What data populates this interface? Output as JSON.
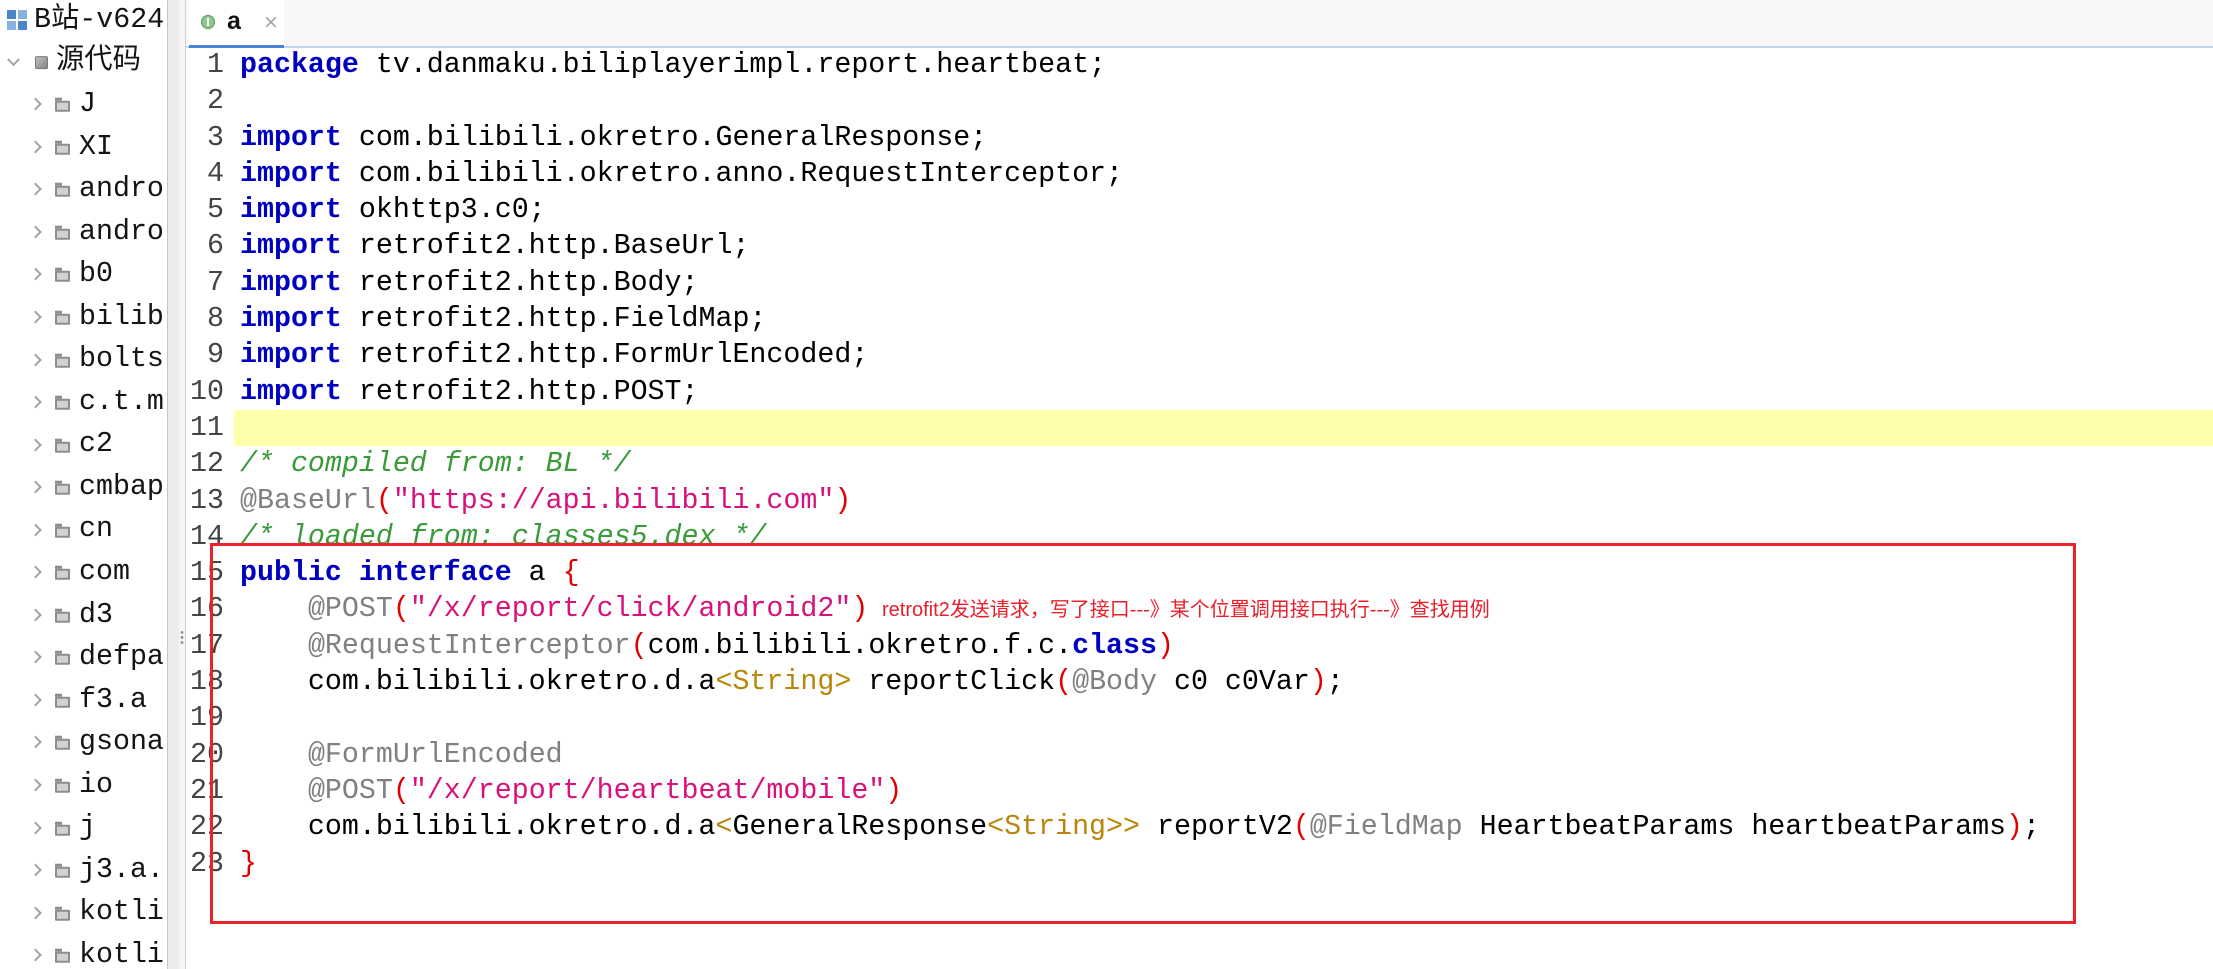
{
  "sidebar": {
    "project": {
      "label": "B站-v624",
      "icon": "project-icon"
    },
    "root": {
      "label": "源代码",
      "icon": "source-root-icon",
      "expanded": true
    },
    "item_icon": "package-icon",
    "items": [
      {
        "label": "J"
      },
      {
        "label": "XI"
      },
      {
        "label": "andro"
      },
      {
        "label": "andro"
      },
      {
        "label": "b0"
      },
      {
        "label": "bilib"
      },
      {
        "label": "bolts"
      },
      {
        "label": "c.t.m"
      },
      {
        "label": "c2"
      },
      {
        "label": "cmbap"
      },
      {
        "label": "cn"
      },
      {
        "label": "com"
      },
      {
        "label": "d3"
      },
      {
        "label": "defpa"
      },
      {
        "label": "f3.a"
      },
      {
        "label": "gsona"
      },
      {
        "label": "io"
      },
      {
        "label": "j"
      },
      {
        "label": "j3.a."
      },
      {
        "label": "kotli"
      },
      {
        "label": "kotli"
      }
    ]
  },
  "tabs": [
    {
      "label": "a",
      "close": "×",
      "icon": "interface-icon",
      "active": true
    }
  ],
  "editor": {
    "current_line": 11,
    "lines": [
      {
        "n": 1,
        "tokens": [
          {
            "keyword": "package"
          },
          {
            "plain": " tv.danmaku.biliplayerimpl.report.heartbeat;"
          }
        ]
      },
      {
        "n": 2,
        "tokens": []
      },
      {
        "n": 3,
        "tokens": [
          {
            "keyword": "import"
          },
          {
            "plain": " com.bilibili.okretro.GeneralResponse;"
          }
        ]
      },
      {
        "n": 4,
        "tokens": [
          {
            "keyword": "import"
          },
          {
            "plain": " com.bilibili.okretro.anno.RequestInterceptor;"
          }
        ]
      },
      {
        "n": 5,
        "tokens": [
          {
            "keyword": "import"
          },
          {
            "plain": " okhttp3.c0;"
          }
        ]
      },
      {
        "n": 6,
        "tokens": [
          {
            "keyword": "import"
          },
          {
            "plain": " retrofit2.http.BaseUrl;"
          }
        ]
      },
      {
        "n": 7,
        "tokens": [
          {
            "keyword": "import"
          },
          {
            "plain": " retrofit2.http.Body;"
          }
        ]
      },
      {
        "n": 8,
        "tokens": [
          {
            "keyword": "import"
          },
          {
            "plain": " retrofit2.http.FieldMap;"
          }
        ]
      },
      {
        "n": 9,
        "tokens": [
          {
            "keyword": "import"
          },
          {
            "plain": " retrofit2.http.FormUrlEncoded;"
          }
        ]
      },
      {
        "n": 10,
        "tokens": [
          {
            "keyword": "import"
          },
          {
            "plain": " retrofit2.http.POST;"
          }
        ]
      },
      {
        "n": 11,
        "tokens": []
      },
      {
        "n": 12,
        "tokens": [
          {
            "comment": "/* compiled from: BL */"
          }
        ]
      },
      {
        "n": 13,
        "tokens": [
          {
            "annotation": "@BaseUrl"
          },
          {
            "bracket": "("
          },
          {
            "string": "\"https://api.bilibili.com\""
          },
          {
            "bracket": ")"
          }
        ]
      },
      {
        "n": 14,
        "tokens": [
          {
            "comment": "/* loaded from: classes5.dex */"
          }
        ]
      },
      {
        "n": 15,
        "tokens": [
          {
            "keyword": "public"
          },
          {
            "plain": " "
          },
          {
            "keyword": "interface"
          },
          {
            "plain": " a "
          },
          {
            "bracket": "{"
          }
        ]
      },
      {
        "n": 16,
        "tokens": [
          {
            "plain": "    "
          },
          {
            "annotation": "@POST"
          },
          {
            "bracket": "("
          },
          {
            "string": "\"/x/report/click/android2\""
          },
          {
            "bracket": ")"
          }
        ]
      },
      {
        "n": 17,
        "tokens": [
          {
            "plain": "    "
          },
          {
            "annotation": "@RequestInterceptor"
          },
          {
            "bracket": "("
          },
          {
            "plain": "com.bilibili.okretro.f.c."
          },
          {
            "keyword": "class"
          },
          {
            "bracket": ")"
          }
        ]
      },
      {
        "n": 18,
        "tokens": [
          {
            "plain": "    com.bilibili.okretro.d.a"
          },
          {
            "generic": "<String>"
          },
          {
            "plain": " reportClick"
          },
          {
            "bracket": "("
          },
          {
            "annotation": "@Body"
          },
          {
            "plain": " c0 c0Var"
          },
          {
            "bracket": ")"
          },
          {
            "plain": ";"
          }
        ]
      },
      {
        "n": 19,
        "tokens": []
      },
      {
        "n": 20,
        "tokens": [
          {
            "plain": "    "
          },
          {
            "annotation": "@FormUrlEncoded"
          }
        ]
      },
      {
        "n": 21,
        "tokens": [
          {
            "plain": "    "
          },
          {
            "annotation": "@POST"
          },
          {
            "bracket": "("
          },
          {
            "string": "\"/x/report/heartbeat/mobile\""
          },
          {
            "bracket": ")"
          }
        ]
      },
      {
        "n": 22,
        "tokens": [
          {
            "plain": "    com.bilibili.okretro.d.a"
          },
          {
            "generic": "<"
          },
          {
            "plain": "GeneralResponse"
          },
          {
            "generic": "<String>>"
          },
          {
            "plain": " reportV2"
          },
          {
            "bracket": "("
          },
          {
            "annotation": "@FieldMap"
          },
          {
            "plain": " HeartbeatParams heartbeatParams"
          },
          {
            "bracket": ")"
          },
          {
            "plain": ";"
          }
        ]
      },
      {
        "n": 23,
        "tokens": [
          {
            "bracket": "}"
          }
        ]
      }
    ]
  },
  "annotation": {
    "note": "retrofit2发送请求，写了接口---》某个位置调用接口执行---》查找用例"
  },
  "colors": {
    "keyword": "#0000c0",
    "plain": "#000000",
    "comment": "#3a9a3a",
    "annotation": "#808080",
    "string": "#d8127a",
    "bracket": "#e00000",
    "generic": "#b8860b",
    "line_number": "#444444",
    "current_line": "#ffffaa",
    "note": "#e8202a",
    "box": "#e8232b"
  }
}
